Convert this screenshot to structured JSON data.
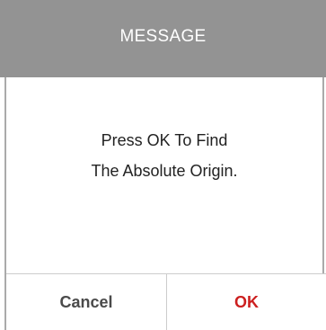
{
  "dialog": {
    "title": "MESSAGE",
    "message_line_1": "Press OK To Find",
    "message_line_2": "The Absolute Origin.",
    "cancel_label": "Cancel",
    "ok_label": "OK"
  },
  "colors": {
    "header_bg": "#939393",
    "header_text": "#ffffff",
    "ok_text": "#cc1f1f",
    "cancel_text": "#4a4a4a",
    "divider": "#cccccc"
  }
}
